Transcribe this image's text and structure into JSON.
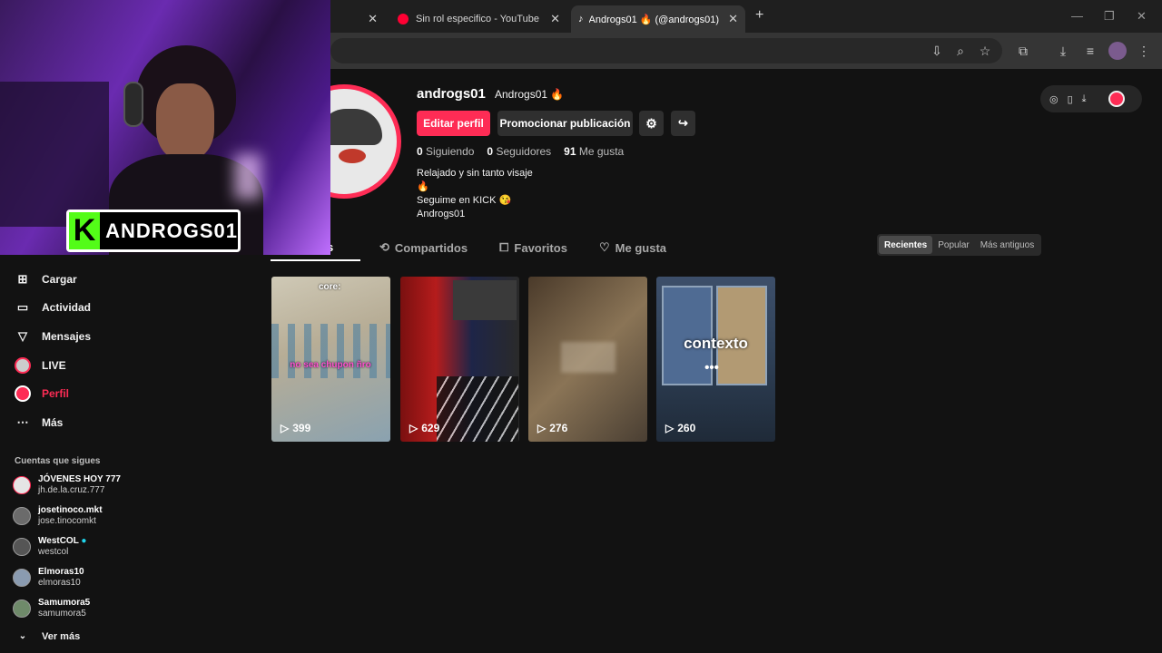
{
  "browser": {
    "tabs": [
      {
        "title": "Sin rol especifico - YouTube"
      },
      {
        "title": "Androgs01 🔥 (@androgs01) | "
      }
    ],
    "new_tab_label": "+"
  },
  "overlay": {
    "badge_letter": "K",
    "streamer_name": "ANDROGS01"
  },
  "profile": {
    "username": "androgs01",
    "display_name": "Androgs01 🔥",
    "edit_button": "Editar perfil",
    "promote_button": "Promocionar publicación",
    "stats": [
      {
        "value": "0",
        "label": "Siguiendo"
      },
      {
        "value": "0",
        "label": "Seguidores"
      },
      {
        "value": "91",
        "label": "Me gusta"
      }
    ],
    "bio": [
      "Relajado y sin tanto visaje",
      "🔥",
      "Seguime en KICK 😘",
      "Androgs01"
    ]
  },
  "profile_tabs": [
    {
      "label": "os"
    },
    {
      "label": "Compartidos"
    },
    {
      "label": "Favoritos"
    },
    {
      "label": "Me gusta"
    }
  ],
  "sort": {
    "options": [
      "Recientes",
      "Popular",
      "Más antiguos"
    ],
    "selected": "Recientes"
  },
  "videos": [
    {
      "views": "399",
      "caption_top": "core:",
      "caption_main": "no sea chupon ñro"
    },
    {
      "views": "629"
    },
    {
      "views": "276"
    },
    {
      "views": "260",
      "caption_main": "contexto",
      "caption_sub": "•••"
    }
  ],
  "sidebar": {
    "items": [
      {
        "label": "Cargar",
        "icon": "plus-square-icon"
      },
      {
        "label": "Actividad",
        "icon": "message-square-icon"
      },
      {
        "label": "Mensajes",
        "icon": "send-icon"
      },
      {
        "label": "LIVE",
        "icon": "live-avatar-icon"
      },
      {
        "label": "Perfil",
        "icon": "profile-avatar-icon"
      },
      {
        "label": "Más",
        "icon": "more-dots-icon"
      }
    ],
    "following_title": "Cuentas que sigues",
    "following": [
      {
        "name": "JÓVENES HOY 777",
        "handle": "jh.de.la.cruz.777"
      },
      {
        "name": "josetinoco.mkt",
        "handle": "jose.tinocomkt"
      },
      {
        "name": "WestCOL",
        "handle": "westcol"
      },
      {
        "name": "Elmoras10",
        "handle": "elmoras10"
      },
      {
        "name": "Samumora5",
        "handle": "samumora5"
      }
    ],
    "see_more": "Ver más"
  },
  "colors": {
    "accent": "#fe2c55",
    "bg": "#121212",
    "button_dark": "#2f2f2f"
  }
}
